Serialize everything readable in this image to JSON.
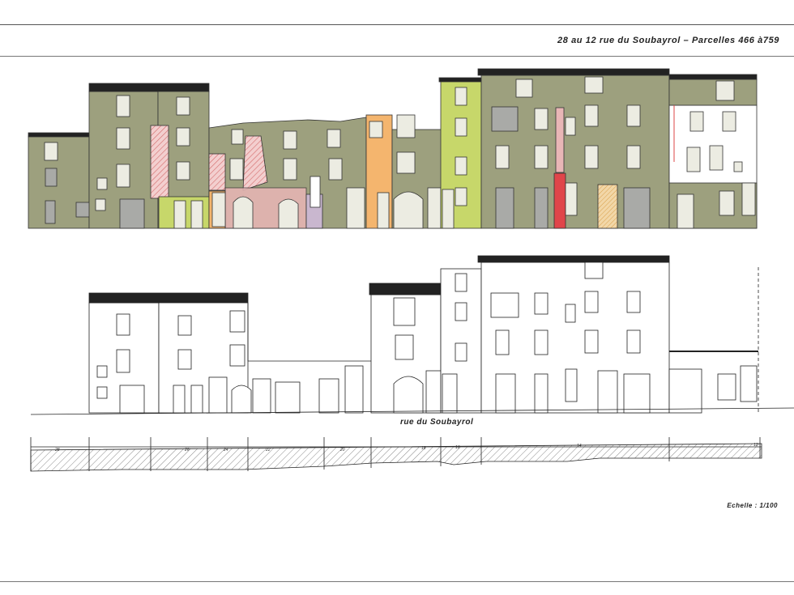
{
  "sheet": {
    "title": "28 au 12 rue du Soubayrol – Parcelles 466 à759",
    "street": "rue du Soubayrol",
    "scale": "Echelle : 1/100"
  },
  "section": {
    "labels": [
      "28",
      "26",
      "24",
      "22",
      "20",
      "18",
      "16",
      "14",
      "12"
    ]
  },
  "colors": {
    "facade_green": "#9da07e",
    "lime": "#c7d76a",
    "orange": "#f4b56e",
    "pink": "#e9b6b6",
    "lavender": "#c9b7cf",
    "white": "#ffffff",
    "red": "#e0454a",
    "grey": "#a9aaa7",
    "stone": "#ecece2",
    "roof": "#222222"
  }
}
